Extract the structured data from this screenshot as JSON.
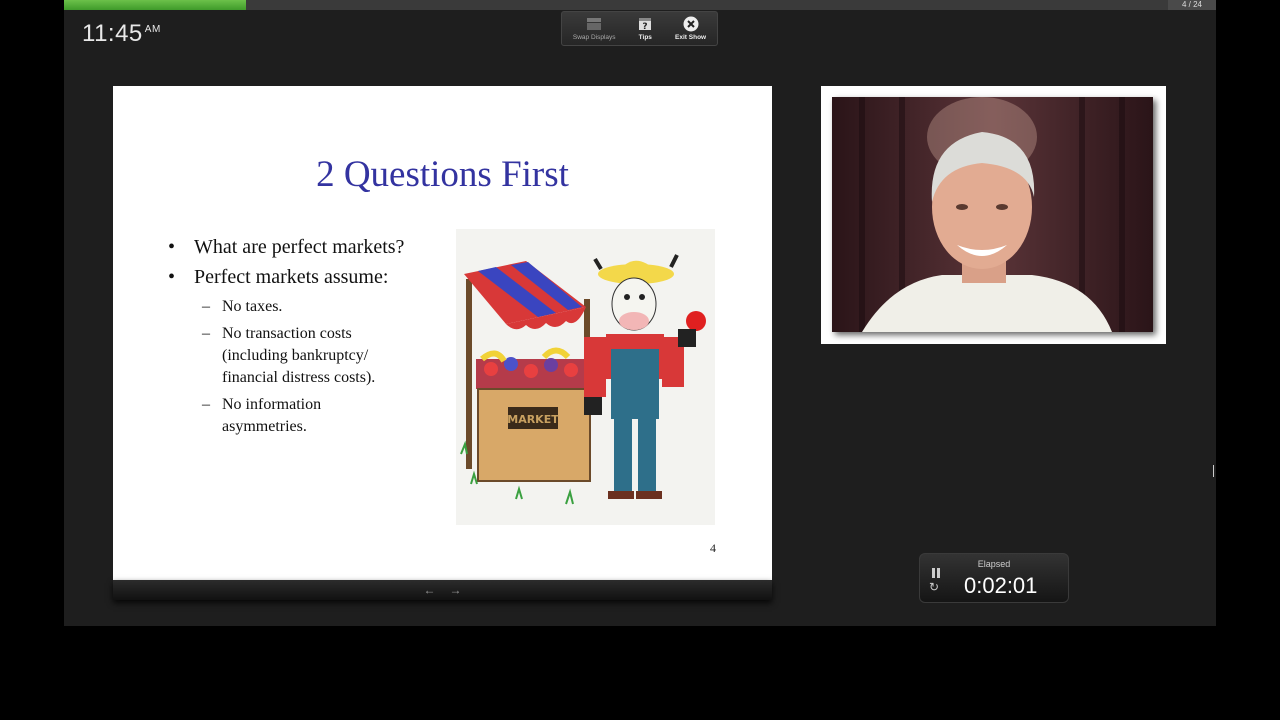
{
  "clock": {
    "time": "11:45",
    "ampm": "AM"
  },
  "progress": {
    "fraction": 0.158,
    "counter": "4 / 24"
  },
  "toolbar": {
    "swap_displays": "Swap Displays",
    "tips": "Tips",
    "exit_show": "Exit Show"
  },
  "slide": {
    "title": "2 Questions First",
    "bullets": [
      "What are perfect markets?",
      "Perfect markets assume:"
    ],
    "sub_bullets": [
      [
        "No taxes."
      ],
      [
        "No transaction costs",
        "(including bankruptcy/",
        "financial distress costs)."
      ],
      [
        "No information",
        "asymmetries."
      ]
    ],
    "illustration_sign": "MARKET",
    "page_number": "4"
  },
  "timer": {
    "label": "Elapsed",
    "value": "0:02:01"
  },
  "colors": {
    "title": "#3333a0",
    "progress": "#4caf35"
  }
}
